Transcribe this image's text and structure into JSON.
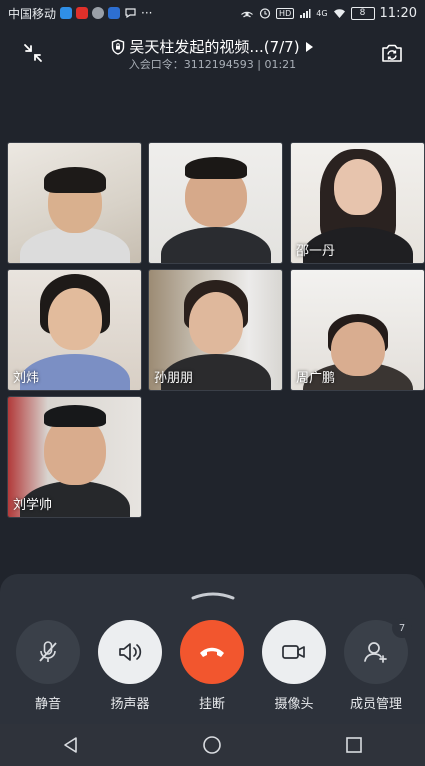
{
  "status_bar": {
    "carrier": "中国移动",
    "icons": [
      "shield-app-icon",
      "red-app-icon",
      "compass-app-icon",
      "jk-app-icon",
      "chat-icon",
      "more-dots-icon",
      "hotspot-icon",
      "alarm-icon",
      "hd-icon",
      "signal-icon",
      "wifi-icon"
    ],
    "more": "···",
    "hd": "HD",
    "network": "4G",
    "battery": "8",
    "time": "11:20"
  },
  "header": {
    "title": "吴天柱发起的视频...(7/7)",
    "subtitle": "入会口令：3112194593 | 01:21"
  },
  "participants": [
    {
      "name": ""
    },
    {
      "name": ""
    },
    {
      "name": "邵一丹"
    },
    {
      "name": "刘炜"
    },
    {
      "name": "孙朋朋"
    },
    {
      "name": "周广鹏"
    },
    {
      "name": "刘学帅"
    }
  ],
  "controls": {
    "mute": "静音",
    "speaker": "扬声器",
    "hangup": "挂断",
    "camera": "摄像头",
    "members": "成员管理",
    "members_badge": "7"
  },
  "colors": {
    "background": "#20242c",
    "panel": "#2d323b",
    "hangup": "#f2562e"
  }
}
